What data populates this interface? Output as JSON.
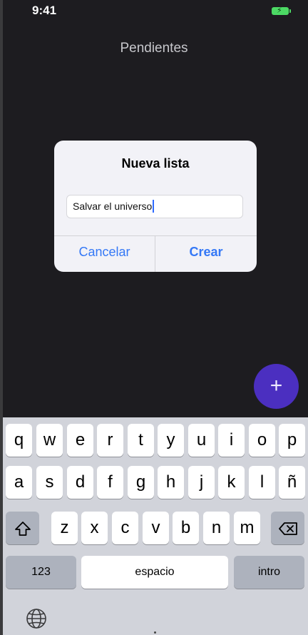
{
  "status_bar": {
    "time": "9:41",
    "battery_icon": "battery-charging-icon",
    "battery_color": "#4cd964"
  },
  "nav": {
    "title": "Pendientes"
  },
  "dialog": {
    "title": "Nueva lista",
    "input_value": "Salvar el universo",
    "cancel_label": "Cancelar",
    "create_label": "Crear",
    "accent": "#3478f6"
  },
  "fab": {
    "label": "+",
    "color": "#4b2fc0"
  },
  "keyboard": {
    "row1": [
      "q",
      "w",
      "e",
      "r",
      "t",
      "y",
      "u",
      "i",
      "o",
      "p"
    ],
    "row2": [
      "a",
      "s",
      "d",
      "f",
      "g",
      "h",
      "j",
      "k",
      "l",
      "ñ"
    ],
    "row3": [
      "z",
      "x",
      "c",
      "v",
      "b",
      "n",
      "m"
    ],
    "numbers_label": "123",
    "space_label": "espacio",
    "return_label": "intro",
    "shift_icon": "shift-icon",
    "delete_icon": "backspace-icon",
    "globe_icon": "globe-icon"
  }
}
